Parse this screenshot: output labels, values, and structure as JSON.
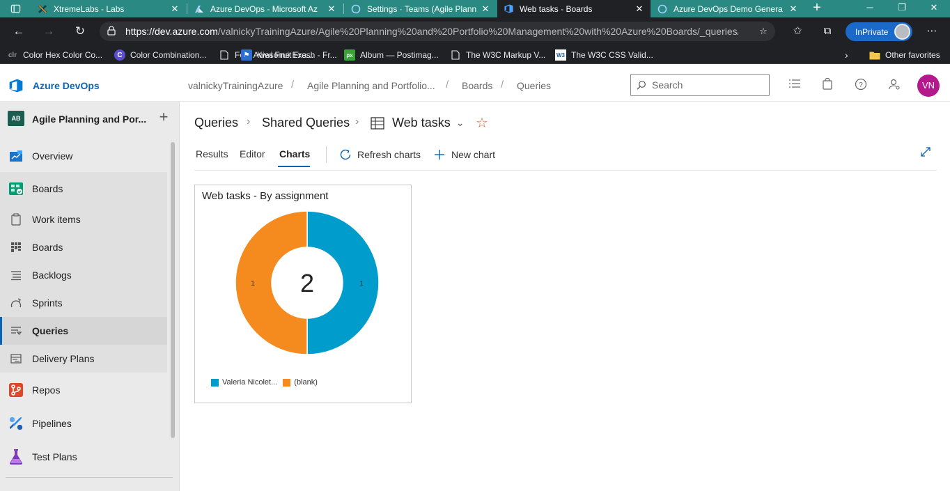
{
  "browser": {
    "tabs": [
      {
        "title": "XtremeLabs - Labs",
        "close": "✕"
      },
      {
        "title": "Azure DevOps - Microsoft Az",
        "close": "✕"
      },
      {
        "title": "Settings · Teams (Agile Planni",
        "close": "✕"
      },
      {
        "title": "Web tasks - Boards",
        "close": "✕"
      },
      {
        "title": "Azure DevOps Demo Genera",
        "close": "✕"
      }
    ],
    "url_host": "https://dev.azure.com",
    "url_rest": "/valnickyTrainingAzure/Agile%20Planning%20and%20Portfolio%20Management%20with%20Azure%20Boards/_queries/...",
    "inprivate_label": "InPrivate",
    "favorites": [
      {
        "label": "Color Hex Color Co...",
        "icon": "clr"
      },
      {
        "label": "Color Combination...",
        "icon": "C"
      },
      {
        "label": "Font Awesome Exa...",
        "icon": "doc"
      },
      {
        "label": "Kiwi Fruit Fresh - Fr...",
        "icon": "flag"
      },
      {
        "label": "Album — Postimag...",
        "icon": "px"
      },
      {
        "label": "The W3C Markup V...",
        "icon": "doc"
      },
      {
        "label": "The W3C CSS Valid...",
        "icon": "W3"
      }
    ],
    "other_favorites": "Other favorites"
  },
  "ado_header": {
    "brand": "Azure DevOps",
    "breadcrumbs": [
      "valnickyTrainingAzure",
      "Agile Planning and Portfolio...",
      "Boards",
      "Queries"
    ],
    "search_placeholder": "Search",
    "avatar_initials": "VN"
  },
  "sidebar": {
    "project_badge": "AB",
    "project_name": "Agile Planning and Por...",
    "items": [
      {
        "label": "Overview"
      },
      {
        "label": "Boards"
      },
      {
        "label": "Work items"
      },
      {
        "label": "Boards"
      },
      {
        "label": "Backlogs"
      },
      {
        "label": "Sprints"
      },
      {
        "label": "Queries"
      },
      {
        "label": "Delivery Plans"
      },
      {
        "label": "Repos"
      },
      {
        "label": "Pipelines"
      },
      {
        "label": "Test Plans"
      }
    ]
  },
  "main": {
    "breadcrumb": [
      "Queries",
      "Shared Queries",
      "Web tasks"
    ],
    "tabs": [
      "Results",
      "Editor",
      "Charts"
    ],
    "active_tab": "Charts",
    "commands": {
      "refresh": "Refresh charts",
      "new_chart": "New chart"
    }
  },
  "chart_data": {
    "type": "pie",
    "title": "Web tasks - By assignment",
    "total": "2",
    "series": [
      {
        "name": "Valeria Nicolet...",
        "value": 1,
        "color": "#009ccc"
      },
      {
        "name": "(blank)",
        "value": 1,
        "color": "#f58b1f"
      }
    ]
  }
}
